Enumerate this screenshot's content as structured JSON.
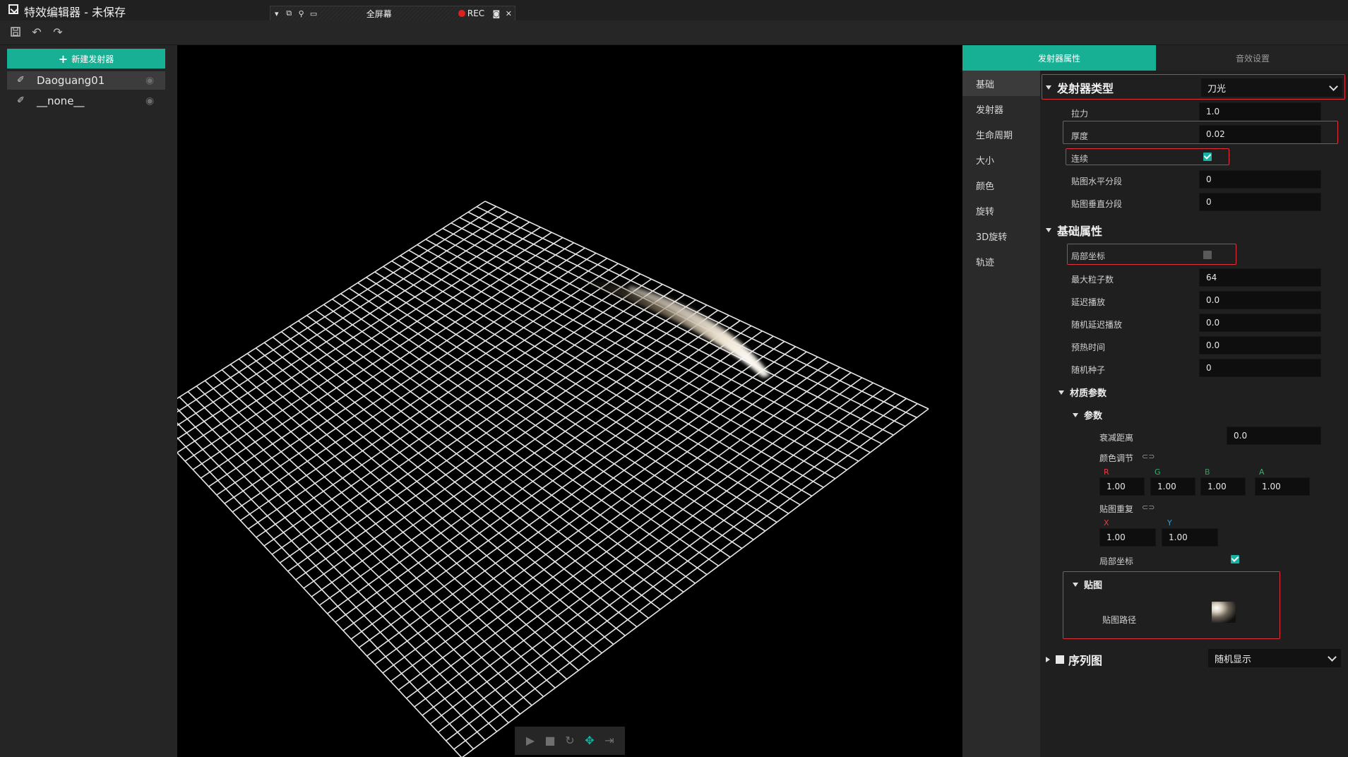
{
  "window": {
    "title": "特效编辑器 - 未保存"
  },
  "float_toolbar": {
    "fullscreen_label": "全屏幕",
    "rec_label": "REC"
  },
  "left": {
    "new_button_label": "新建发射器",
    "emitters": [
      {
        "name": "Daoguang01",
        "selected": true
      },
      {
        "name": "__none__",
        "selected": false
      }
    ]
  },
  "tabs": [
    {
      "label": "发射器属性",
      "active": true
    },
    {
      "label": "音效设置",
      "active": false
    }
  ],
  "nav": [
    {
      "label": "基础",
      "active": true
    },
    {
      "label": "发射器"
    },
    {
      "label": "生命周期"
    },
    {
      "label": "大小"
    },
    {
      "label": "颜色"
    },
    {
      "label": "旋转"
    },
    {
      "label": "3D旋转"
    },
    {
      "label": "轨迹"
    }
  ],
  "emitter_type": {
    "title": "发射器类型",
    "value": "刀光",
    "rows": [
      {
        "label": "拉力",
        "value": "1.0"
      },
      {
        "label": "厚度",
        "value": "0.02"
      },
      {
        "label": "连续",
        "checked": true
      },
      {
        "label": "贴图水平分段",
        "value": "0"
      },
      {
        "label": "贴图垂直分段",
        "value": "0"
      }
    ]
  },
  "basic": {
    "title": "基础属性",
    "local_coords_label": "局部坐标",
    "local_coords_checked": false,
    "rows": [
      {
        "label": "最大粒子数",
        "value": "64"
      },
      {
        "label": "延迟播放",
        "value": "0.0"
      },
      {
        "label": "随机延迟播放",
        "value": "0.0"
      },
      {
        "label": "预热时间",
        "value": "0.0"
      },
      {
        "label": "随机种子",
        "value": "0"
      }
    ]
  },
  "material": {
    "title": "材质参数",
    "params_title": "参数",
    "fade_label": "衰减距离",
    "fade_value": "0.0",
    "color_label": "颜色调节",
    "color": {
      "r_label": "R",
      "g_label": "G",
      "b_label": "B",
      "a_label": "A",
      "r": "1.00",
      "g": "1.00",
      "b": "1.00",
      "a": "1.00"
    },
    "repeat_label": "贴图重复",
    "repeat": {
      "x_label": "X",
      "y_label": "Y",
      "x": "1.00",
      "y": "1.00"
    },
    "local_label": "局部坐标",
    "local_checked": true,
    "texture_title": "贴图",
    "texture_path_label": "贴图路径"
  },
  "sequence": {
    "title": "序列图",
    "value": "随机显示"
  },
  "colors": {
    "accent": "#17b095",
    "highlight": "#e0313b",
    "r": "#e0404a",
    "g": "#2fb36a",
    "b": "#2f9f5a",
    "a": "#2fb36a"
  },
  "icons": [
    "save-icon",
    "undo-icon",
    "redo-icon",
    "eye-icon",
    "emitter-icon",
    "play-icon",
    "stop-icon",
    "replay-icon",
    "move-icon",
    "step-icon",
    "link-icon"
  ]
}
